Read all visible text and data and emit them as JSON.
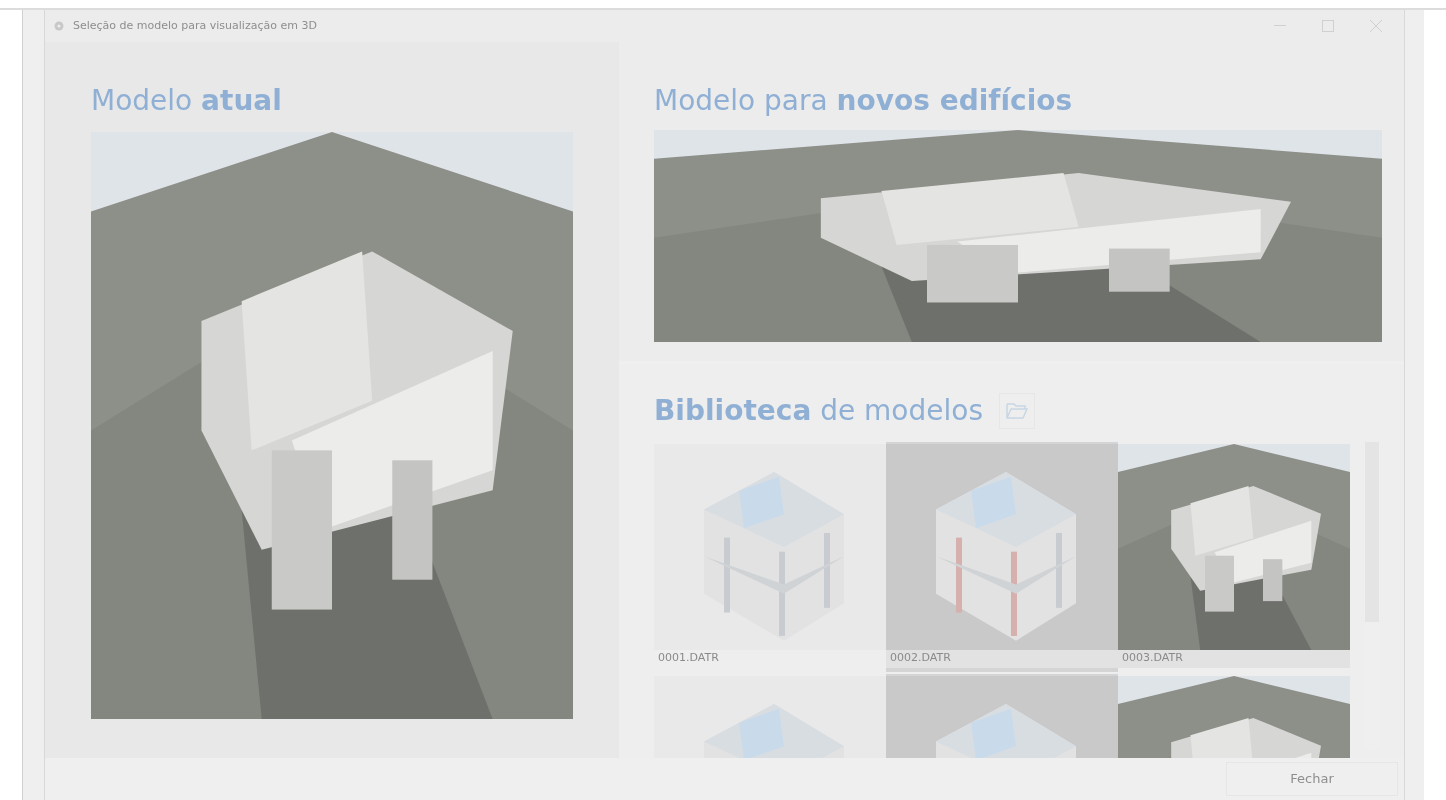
{
  "window": {
    "title": "Seleção de modelo para visualização em 3D"
  },
  "current_model": {
    "heading": "Modelo **atual**"
  },
  "new_buildings_model": {
    "heading": "Modelo para **novos edifícios**"
  },
  "library": {
    "heading": "**Biblioteca** de modelos",
    "items": [
      {
        "label": "0001.DATR",
        "kind": "wireframe"
      },
      {
        "label": "0002.DATR",
        "kind": "wireframe_dark"
      },
      {
        "label": "0003.DATR",
        "kind": "render"
      },
      {
        "kind": "wireframe"
      },
      {
        "kind": "wireframe_dark"
      },
      {
        "kind": "render"
      }
    ]
  },
  "buttons": [
    "Fechar"
  ]
}
